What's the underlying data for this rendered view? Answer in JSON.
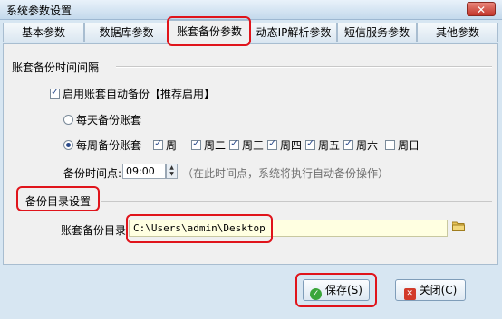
{
  "window": {
    "title": "系统参数设置",
    "close_label": "✕"
  },
  "tabs": [
    {
      "label": "基本参数"
    },
    {
      "label": "数据库参数"
    },
    {
      "label": "账套备份参数"
    },
    {
      "label": "动态IP解析参数"
    },
    {
      "label": "短信服务参数"
    },
    {
      "label": "其他参数"
    }
  ],
  "backup_interval": {
    "section_title": "账套备份时间间隔",
    "auto_backup_label": "启用账套自动备份【推荐启用】",
    "daily_label": "每天备份账套",
    "weekly_label": "每周备份账套",
    "weekdays": [
      {
        "label": "周一",
        "checked": true
      },
      {
        "label": "周二",
        "checked": true
      },
      {
        "label": "周三",
        "checked": true
      },
      {
        "label": "周四",
        "checked": true
      },
      {
        "label": "周五",
        "checked": true
      },
      {
        "label": "周六",
        "checked": true
      },
      {
        "label": "周日",
        "checked": false
      }
    ],
    "time_label": "备份时间点:",
    "time_value": "09:00",
    "time_hint": "（在此时间点，系统将执行自动备份操作）"
  },
  "backup_dir": {
    "section_title": "备份目录设置",
    "path_label": "账套备份目录",
    "path_value": "C:\\Users\\admin\\Desktop"
  },
  "buttons": {
    "save_label": "保存(S)",
    "close_label": "关闭(C)"
  },
  "colors": {
    "highlight": "#e0141b",
    "path_bg": "#ffffe1",
    "save_icon": "#3aa63a",
    "close_icon": "#d23a2a"
  }
}
